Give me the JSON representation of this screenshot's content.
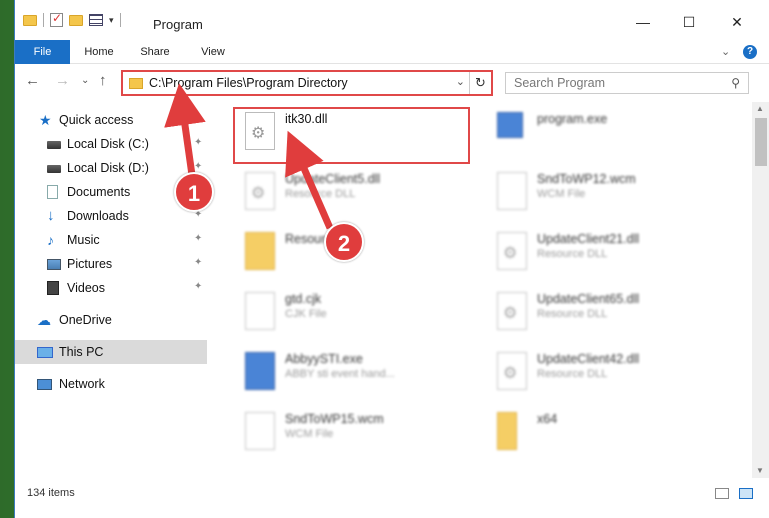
{
  "window": {
    "title": "Program",
    "minimize": "—",
    "maximize": "☐",
    "close": "✕"
  },
  "ribbon": {
    "tabs": [
      "File",
      "Home",
      "Share",
      "View"
    ],
    "expand": "⌄",
    "help": "?"
  },
  "nav": {
    "back": "←",
    "forward": "→",
    "recent": "⌄",
    "up": "↑",
    "address": "C:\\Program Files\\Program Directory",
    "address_dropdown": "⌄",
    "refresh": "↻",
    "search_placeholder": "Search Program",
    "search_icon": "⚲"
  },
  "sidebar": {
    "items": [
      {
        "label": "Quick access",
        "icon": "star-icon",
        "glyph": "★"
      },
      {
        "label": "Local Disk (C:)",
        "icon": "disk-icon",
        "pinned": true
      },
      {
        "label": "Local Disk (D:)",
        "icon": "disk-icon",
        "pinned": true
      },
      {
        "label": "Documents",
        "icon": "documents-icon",
        "pinned": true
      },
      {
        "label": "Downloads",
        "icon": "download-icon",
        "glyph": "↓",
        "pinned": true
      },
      {
        "label": "Music",
        "icon": "music-icon",
        "glyph": "♪",
        "pinned": true
      },
      {
        "label": "Pictures",
        "icon": "pictures-icon",
        "pinned": true
      },
      {
        "label": "Videos",
        "icon": "videos-icon",
        "pinned": true
      },
      {
        "label": "OneDrive",
        "icon": "cloud-icon",
        "glyph": "☁"
      },
      {
        "label": "This PC",
        "icon": "computer-icon",
        "selected": true
      },
      {
        "label": "Network",
        "icon": "network-icon"
      }
    ],
    "pin_glyph": "📌"
  },
  "files": [
    {
      "name": "itk30.dll",
      "type": "",
      "icon": "gear"
    },
    {
      "name": "program.exe",
      "type": "",
      "icon": "exe"
    },
    {
      "name": "UpdateClient5.dll",
      "type": "Resource DLL",
      "icon": "gear"
    },
    {
      "name": "SndToWP12.wcm",
      "type": "WCM File",
      "icon": "doc"
    },
    {
      "name": "Resources",
      "type": "",
      "icon": "folder"
    },
    {
      "name": "UpdateClient21.dll",
      "type": "Resource DLL",
      "icon": "gear"
    },
    {
      "name": "gtd.cjk",
      "type": "CJK File",
      "icon": "doc"
    },
    {
      "name": "UpdateClient65.dll",
      "type": "Resource DLL",
      "icon": "gear"
    },
    {
      "name": "AbbyySTI.exe",
      "type": "ABBY sti event hand...",
      "icon": "exe"
    },
    {
      "name": "UpdateClient42.dll",
      "type": "Resource DLL",
      "icon": "gear"
    },
    {
      "name": "SndToWP15.wcm",
      "type": "WCM File",
      "icon": "doc"
    },
    {
      "name": "x64",
      "type": "",
      "icon": "folder"
    }
  ],
  "status": {
    "count": "134 items"
  },
  "annotations": {
    "step1": "1",
    "step2": "2",
    "color": "#e03d3d"
  }
}
